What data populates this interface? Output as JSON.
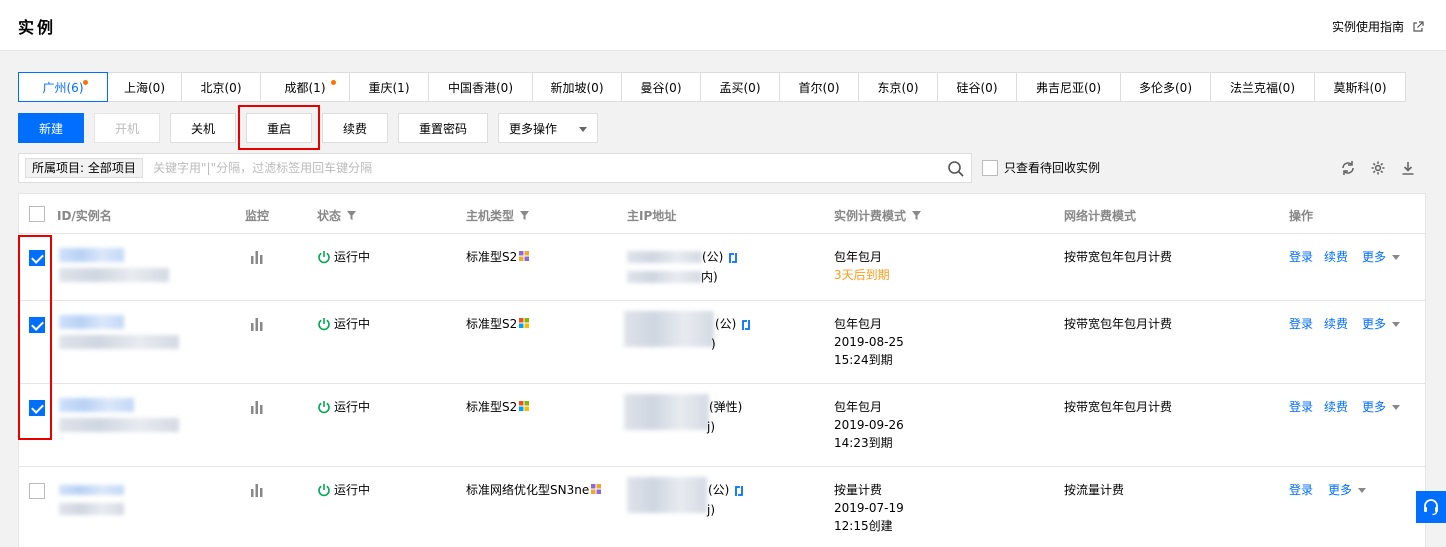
{
  "header": {
    "title": "实例",
    "guide_label": "实例使用指南"
  },
  "regions": [
    {
      "label": "广州(6)",
      "active": true,
      "dot": true
    },
    {
      "label": "上海(0)"
    },
    {
      "label": "北京(0)"
    },
    {
      "label": "成都(1)",
      "dot": true
    },
    {
      "label": "重庆(1)"
    },
    {
      "label": "中国香港(0)"
    },
    {
      "label": "新加坡(0)"
    },
    {
      "label": "曼谷(0)"
    },
    {
      "label": "孟买(0)"
    },
    {
      "label": "首尔(0)"
    },
    {
      "label": "东京(0)"
    },
    {
      "label": "硅谷(0)"
    },
    {
      "label": "弗吉尼亚(0)"
    },
    {
      "label": "多伦多(0)"
    },
    {
      "label": "法兰克福(0)"
    },
    {
      "label": "莫斯科(0)"
    }
  ],
  "toolbar": {
    "new": "新建",
    "start": "开机",
    "shutdown": "关机",
    "restart": "重启",
    "renew": "续费",
    "reset_password": "重置密码",
    "more_ops": "更多操作"
  },
  "search": {
    "scope_tag": "所属项目: 全部项目",
    "placeholder": "关键字用\"|\"分隔，过滤标签用回车键分隔",
    "recycle_label": "只查看待回收实例"
  },
  "table": {
    "headers": {
      "id": "ID/实例名",
      "monitor": "监控",
      "status": "状态",
      "type": "主机类型",
      "ip": "主IP地址",
      "billing": "实例计费模式",
      "net_billing": "网络计费模式",
      "ops": "操作"
    },
    "rows": [
      {
        "checked": true,
        "status": "运行中",
        "type": "标准型S2",
        "os": "linux",
        "ip_l1_suffix": "(公)",
        "ip_l2_suffix": "内)",
        "swap": true,
        "billing_l1": "包年包月",
        "billing_l2": "3天后到期",
        "billing_l3": "",
        "warn": true,
        "net": "按带宽包年包月计费",
        "login": "登录",
        "renew": "续费",
        "more": "更多"
      },
      {
        "checked": true,
        "status": "运行中",
        "type": "标准型S2",
        "os": "windows",
        "ip_l1_suffix": "(公)",
        "ip_l2_suffix": ")",
        "swap": true,
        "billing_l1": "包年包月",
        "billing_l2": "2019-08-25",
        "billing_l3": "15:24到期",
        "net": "按带宽包年包月计费",
        "login": "登录",
        "renew": "续费",
        "more": "更多"
      },
      {
        "checked": true,
        "status": "运行中",
        "type": "标准型S2",
        "os": "windows",
        "ip_l1_suffix": "(弹性)",
        "ip_l2_suffix": "j)",
        "swap": false,
        "billing_l1": "包年包月",
        "billing_l2": "2019-09-26",
        "billing_l3": "14:23到期",
        "net": "按带宽包年包月计费",
        "login": "登录",
        "renew": "续费",
        "more": "更多"
      },
      {
        "checked": false,
        "status": "运行中",
        "type": "标准网络优化型SN3ne",
        "os": "linux",
        "ip_l1_suffix": "(公)",
        "ip_l2_suffix": "j)",
        "swap": true,
        "billing_l1": "按量计费",
        "billing_l2": "2019-07-19",
        "billing_l3": "12:15创建",
        "net": "按流量计费",
        "login": "登录",
        "renew": "",
        "more": "更多"
      }
    ]
  },
  "colors": {
    "accent": "#006eff",
    "running": "#00a854",
    "warning": "#ff9c19",
    "highlight": "#e60000"
  }
}
